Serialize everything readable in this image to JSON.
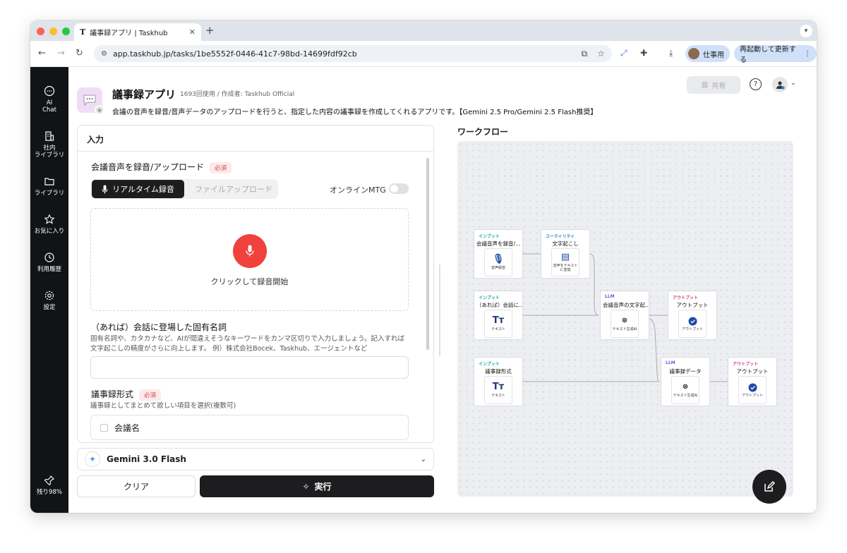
{
  "browser": {
    "tab_title": "議事録アプリ | Taskhub",
    "tab_icon": "T",
    "url": "app.taskhub.jp/tasks/1be5552f-0446-41c7-98bd-14699fdf92cb",
    "profile_name": "仕事用",
    "update_label": "再起動して更新する"
  },
  "sidebar": {
    "items": [
      {
        "label": "AI\nChat",
        "icon": "chat-icon"
      },
      {
        "label": "社内\nライブラリ",
        "icon": "building-icon"
      },
      {
        "label": "ライブラリ",
        "icon": "folder-icon"
      },
      {
        "label": "お気に入り",
        "icon": "star-icon"
      },
      {
        "label": "利用履歴",
        "icon": "history-icon"
      },
      {
        "label": "設定",
        "icon": "gear-icon"
      }
    ],
    "remaining": "残り98%"
  },
  "app": {
    "title": "議事録アプリ",
    "meta": "1693回使用 / 作成者: Taskhub Official",
    "description": "会議の音声を録音/音声データのアップロードを行うと、指定した内容の議事録を作成してくれるアプリです。【Gemini 2.5 Pro/Gemini 2.5 Flash推奨】",
    "share_label": "共有"
  },
  "input": {
    "header": "入力",
    "audio_label": "会議音声を録音/アップロード",
    "required": "必須",
    "seg_realtime": "リアルタイム録音",
    "seg_upload": "ファイルアップロード",
    "online_label": "オンラインMTG",
    "record_hint": "クリックして録音開始",
    "nouns_label": "（あれば）会話に登場した固有名詞",
    "nouns_help": "固有名詞や、カタカナなど、AIが間違えそうなキーワードをカンマ区切りで入力しましょう。記入すれば文字起こしの精度がさらに向上します。 例）株式会社Bocek、Taskhub、エージェントなど",
    "nouns_value": "",
    "format_label": "議事録形式",
    "format_help": "議事録としてまとめて欲しい項目を選択(複数可)",
    "format_option": "会議名"
  },
  "model": {
    "name": "Gemini 3.0 Flash"
  },
  "actions": {
    "clear": "クリア",
    "run": "実行"
  },
  "workflow": {
    "title": "ワークフロー",
    "nodes": [
      {
        "tag": "インプット",
        "title": "会議音声を録音/...",
        "sub": "音声録音"
      },
      {
        "tag": "ユーティリティ",
        "title": "文字起こし",
        "sub": "音声をテキスト\nに変換"
      },
      {
        "tag": "インプット",
        "title": "（あれば）会話に...",
        "sub": "テキスト"
      },
      {
        "tag": "LLM",
        "title": "会議音声の文字起...",
        "sub": "テキスト生成AI"
      },
      {
        "tag": "アウトプット",
        "title": "アウトプット",
        "sub": "アウトプット"
      },
      {
        "tag": "インプット",
        "title": "議事録形式",
        "sub": "テキスト"
      },
      {
        "tag": "LLM",
        "title": "議事録データ",
        "sub": "テキスト生成AI"
      },
      {
        "tag": "アウトプット",
        "title": "アウトプット",
        "sub": "アウトプット"
      }
    ]
  },
  "colors": {
    "tag_input": "#1aa39a",
    "tag_utility": "#2f7fd6",
    "tag_llm": "#6d56d8",
    "tag_output": "#d6457a",
    "record": "#f0413c"
  }
}
